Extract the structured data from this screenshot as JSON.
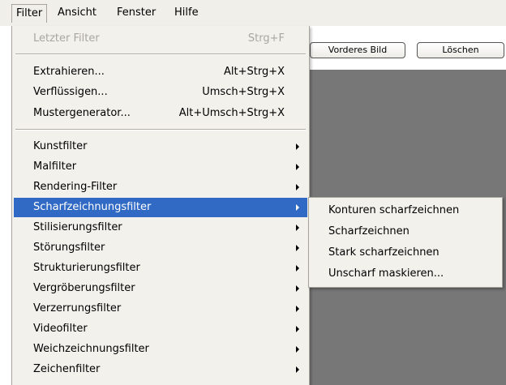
{
  "menubar": {
    "items": [
      "Filter",
      "Ansicht",
      "Fenster",
      "Hilfe"
    ]
  },
  "panel": {
    "buttons": [
      "Vorderes Bild",
      "Löschen"
    ]
  },
  "filter_menu": {
    "items": [
      {
        "label": "Letzter Filter",
        "shortcut": "Strg+F",
        "disabled": true
      },
      {
        "label": "Extrahieren...",
        "shortcut": "Alt+Strg+X"
      },
      {
        "label": "Verflüssigen...",
        "shortcut": "Umsch+Strg+X"
      },
      {
        "label": "Mustergenerator...",
        "shortcut": "Alt+Umsch+Strg+X"
      },
      {
        "label": "Kunstfilter",
        "submenu": true
      },
      {
        "label": "Malfilter",
        "submenu": true
      },
      {
        "label": "Rendering-Filter",
        "submenu": true
      },
      {
        "label": "Scharfzeichnungsfilter",
        "submenu": true,
        "active": true
      },
      {
        "label": "Stilisierungsfilter",
        "submenu": true
      },
      {
        "label": "Störungsfilter",
        "submenu": true
      },
      {
        "label": "Strukturierungsfilter",
        "submenu": true
      },
      {
        "label": "Vergröberungsfilter",
        "submenu": true
      },
      {
        "label": "Verzerrungsfilter",
        "submenu": true
      },
      {
        "label": "Videofilter",
        "submenu": true
      },
      {
        "label": "Weichzeichnungsfilter",
        "submenu": true
      },
      {
        "label": "Zeichenfilter",
        "submenu": true
      }
    ]
  },
  "submenu": {
    "items": [
      "Konturen scharfzeichnen",
      "Scharfzeichnen",
      "Stark scharfzeichnen",
      "Unscharf maskieren..."
    ]
  },
  "colors": {
    "highlight": "#316ac5",
    "menu_bg": "#f3f1ec",
    "panel_gray": "#777777"
  }
}
